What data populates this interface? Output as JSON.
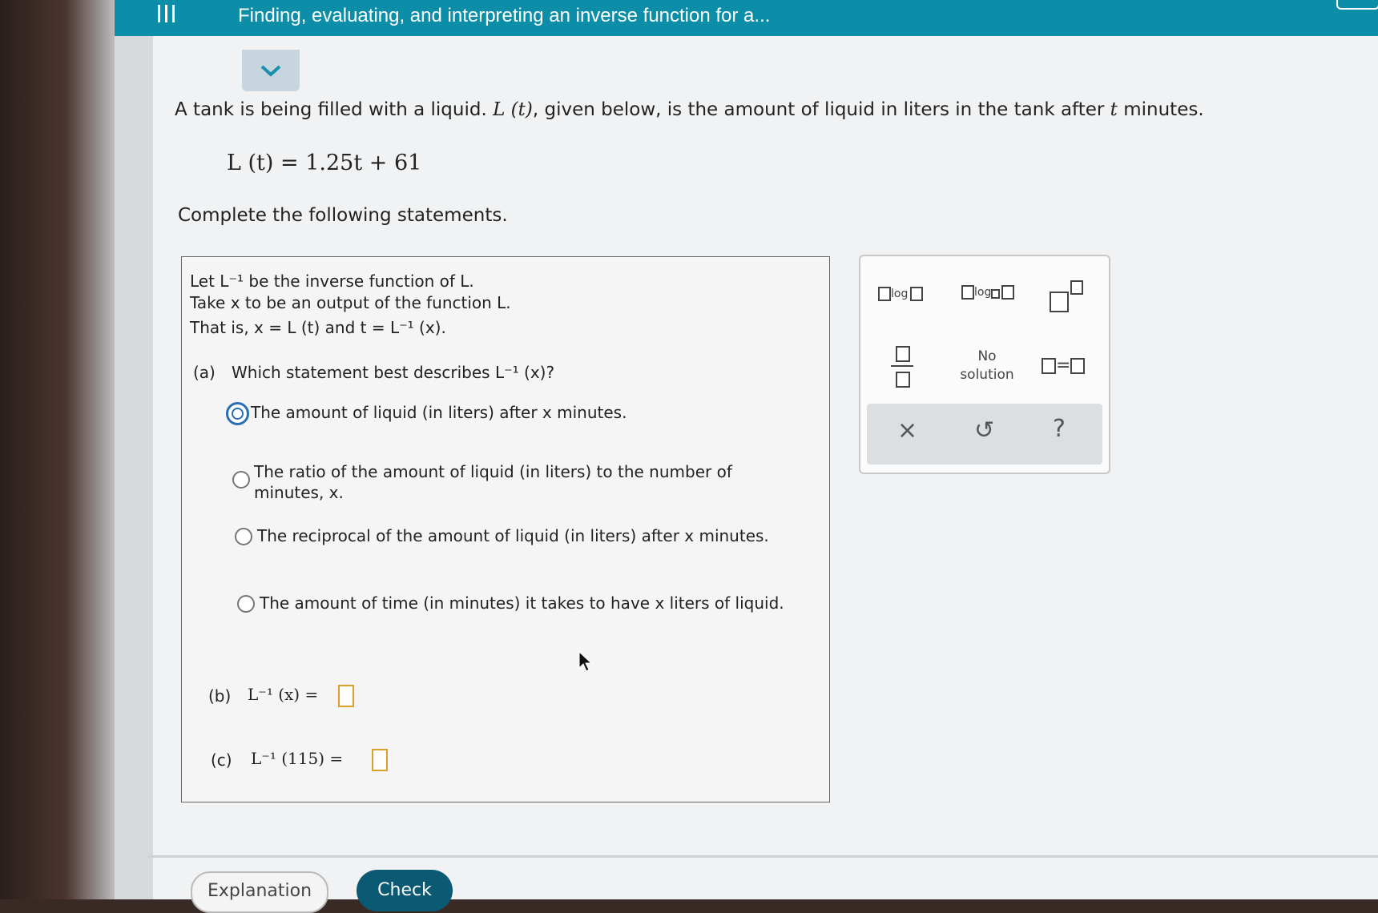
{
  "header": {
    "title": "Finding, evaluating, and interpreting an inverse function for a..."
  },
  "problem": {
    "intro_pre": "A tank is being filled with a liquid. ",
    "intro_func": "L (t)",
    "intro_mid": ", given below, is the amount of liquid in liters in the tank after ",
    "intro_var": "t",
    "intro_post": " minutes.",
    "formula": "L (t) = 1.25t + 61",
    "instruction": "Complete the following statements."
  },
  "question_box": {
    "line1": "Let L⁻¹ be the inverse function of L.",
    "line2": "Take x to be an output of the function L.",
    "line3": "That is, x = L (t) and t = L⁻¹ (x).",
    "part_a_label": "(a)",
    "part_a_question": "Which statement best describes L⁻¹ (x)?",
    "options": [
      {
        "label": "The amount of liquid (in liters) after x minutes.",
        "selected": true
      },
      {
        "label": "The ratio of the amount of liquid (in liters) to the number of minutes, x.",
        "selected": false
      },
      {
        "label": "The reciprocal of the amount of liquid (in liters) after x minutes.",
        "selected": false
      },
      {
        "label": "The amount of time (in minutes) it takes to have x liters of liquid.",
        "selected": false
      }
    ],
    "part_b_label": "(b)",
    "part_b_expr": "L⁻¹ (x) =",
    "part_c_label": "(c)",
    "part_c_expr": "L⁻¹ (115) ="
  },
  "palette": {
    "log_label": "log",
    "log_base_label": "log",
    "no_solution_line1": "No",
    "no_solution_line2": "solution",
    "equals": "=",
    "clear": "×",
    "undo": "↺",
    "help": "?"
  },
  "footer": {
    "explanation": "Explanation",
    "check": "Check"
  },
  "colors": {
    "header": "#0d8ea8",
    "check_button": "#0b5a73",
    "selected_radio": "#2a6fb4",
    "answer_box": "#d9a12a"
  }
}
